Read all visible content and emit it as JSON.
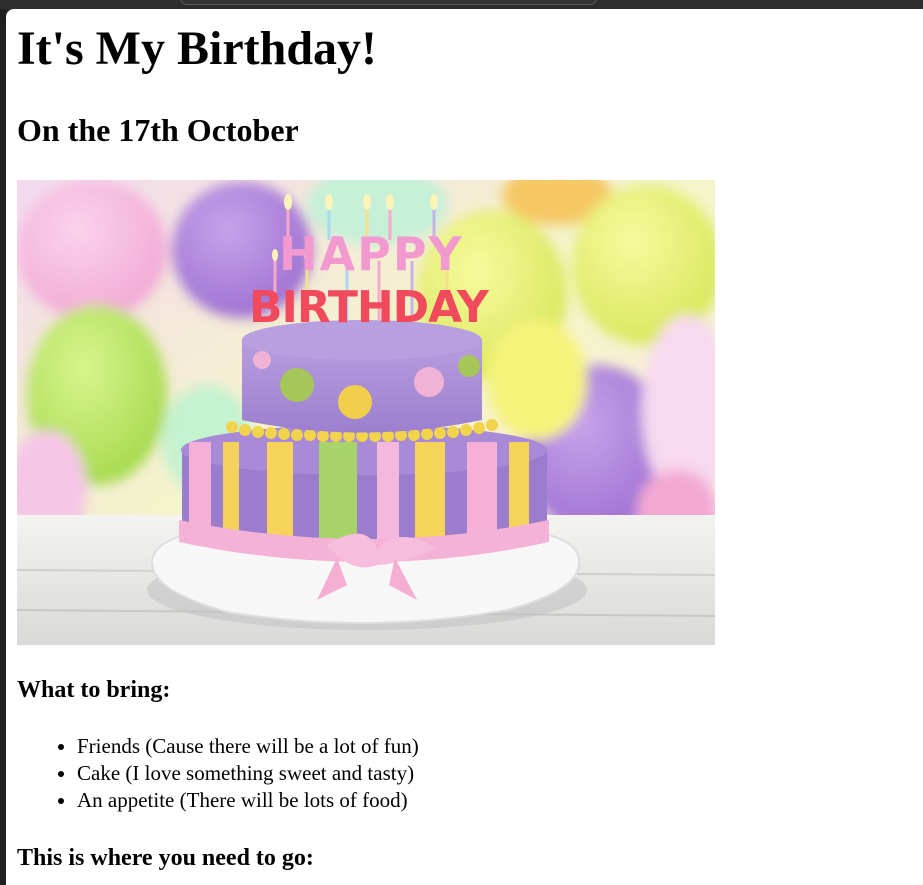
{
  "page": {
    "title": "It's My Birthday!",
    "subtitle": "On the 17th October",
    "bring_heading": "What to bring:",
    "bring_items": [
      "Friends (Cause there will be a lot of fun)",
      "Cake (I love something sweet and tasty)",
      "An appetite (There will be lots of food)"
    ],
    "location_heading": "This is where you need to go:"
  },
  "image": {
    "name": "birthday-cake-photo",
    "cake_letters_top": "HAPPY",
    "cake_letters_bottom": "BIRTHDAY"
  },
  "colors": {
    "page_background": "#ffffff",
    "text": "#000000",
    "browser_chrome": "#2d2d2d"
  }
}
